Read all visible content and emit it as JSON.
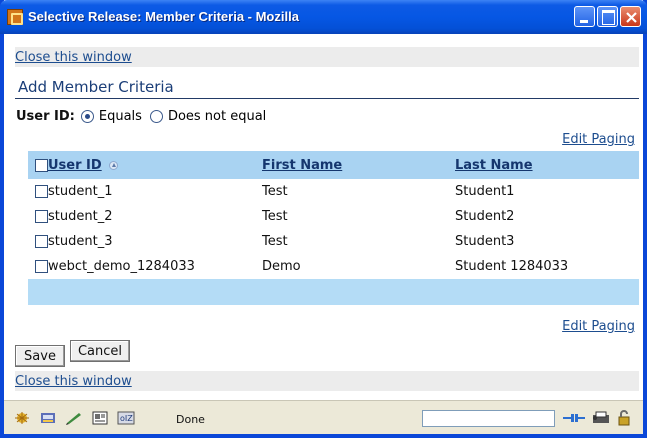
{
  "window": {
    "title": "Selective Release: Member Criteria - Mozilla"
  },
  "links": {
    "close_top": "Close this window",
    "close_bottom": "Close this window",
    "edit_paging_top": "Edit Paging",
    "edit_paging_bottom": "Edit Paging"
  },
  "heading": "Add Member Criteria",
  "filter": {
    "label": "User ID:",
    "options": [
      {
        "label": "Equals",
        "selected": true
      },
      {
        "label": "Does not equal",
        "selected": false
      }
    ]
  },
  "table": {
    "columns": [
      "User ID",
      "First Name",
      "Last Name"
    ],
    "sorted_column": "User ID",
    "sort_direction": "ascending",
    "rows": [
      {
        "user_id": "student_1",
        "first_name": "Test",
        "last_name": "Student1"
      },
      {
        "user_id": "student_2",
        "first_name": "Test",
        "last_name": "Student2"
      },
      {
        "user_id": "student_3",
        "first_name": "Test",
        "last_name": "Student3"
      },
      {
        "user_id": "webct_demo_1284033",
        "first_name": "Demo",
        "last_name": "Student 1284033"
      }
    ]
  },
  "buttons": {
    "save": "Save",
    "cancel": "Cancel"
  },
  "statusbar": {
    "text": "Done",
    "icons": [
      "navigator-icon",
      "mail-icon",
      "composer-icon",
      "address-book-icon",
      "chat-icon"
    ],
    "right_icons": [
      "connection-icon",
      "print-icon",
      "security-lock-icon"
    ]
  },
  "colors": {
    "titlebar": "#0657e4",
    "table_header": "#a9d3f2",
    "link": "#1d4d8f",
    "heading": "#1b3e78"
  }
}
